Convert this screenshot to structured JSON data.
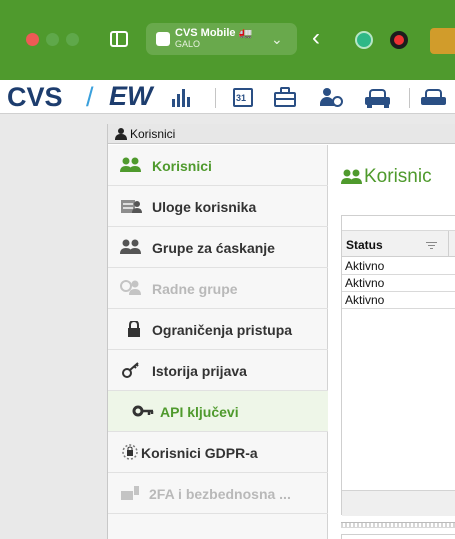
{
  "browser": {
    "tab": {
      "title": "CVS Mobile 🚛",
      "subtitle": "GALO"
    },
    "colors": {
      "titlebar": "#4f9a2d",
      "close": "#ee5a55"
    }
  },
  "app": {
    "brand_left": "CVS",
    "brand_slash": "/",
    "brand_right": "EW",
    "calendar_day": "31"
  },
  "window": {
    "title": "Korisnici"
  },
  "sidebar": {
    "items": [
      {
        "label": "Korisnici",
        "icon": "users-icon",
        "state": "active"
      },
      {
        "label": "Uloge korisnika",
        "icon": "user-roles-icon",
        "state": "normal"
      },
      {
        "label": "Grupe za ćaskanje",
        "icon": "chat-groups-icon",
        "state": "normal"
      },
      {
        "label": "Radne grupe",
        "icon": "work-groups-icon",
        "state": "disabled"
      },
      {
        "label": "Ograničenja pristupa",
        "icon": "lock-icon",
        "state": "normal"
      },
      {
        "label": "Istorija prijava",
        "icon": "key-icon",
        "state": "normal"
      },
      {
        "label": "API ključevi",
        "icon": "api-key-icon",
        "state": "selected"
      },
      {
        "label": "Korisnici GDPR-a",
        "icon": "gdpr-icon",
        "state": "normal"
      },
      {
        "label": "2FA i bezbednosna ...",
        "icon": "2fa-icon",
        "state": "disabled"
      }
    ]
  },
  "content": {
    "title": "Korisnic",
    "grid": {
      "column": "Status",
      "rows": [
        "Aktivno",
        "Aktivno",
        "Aktivno"
      ]
    }
  }
}
